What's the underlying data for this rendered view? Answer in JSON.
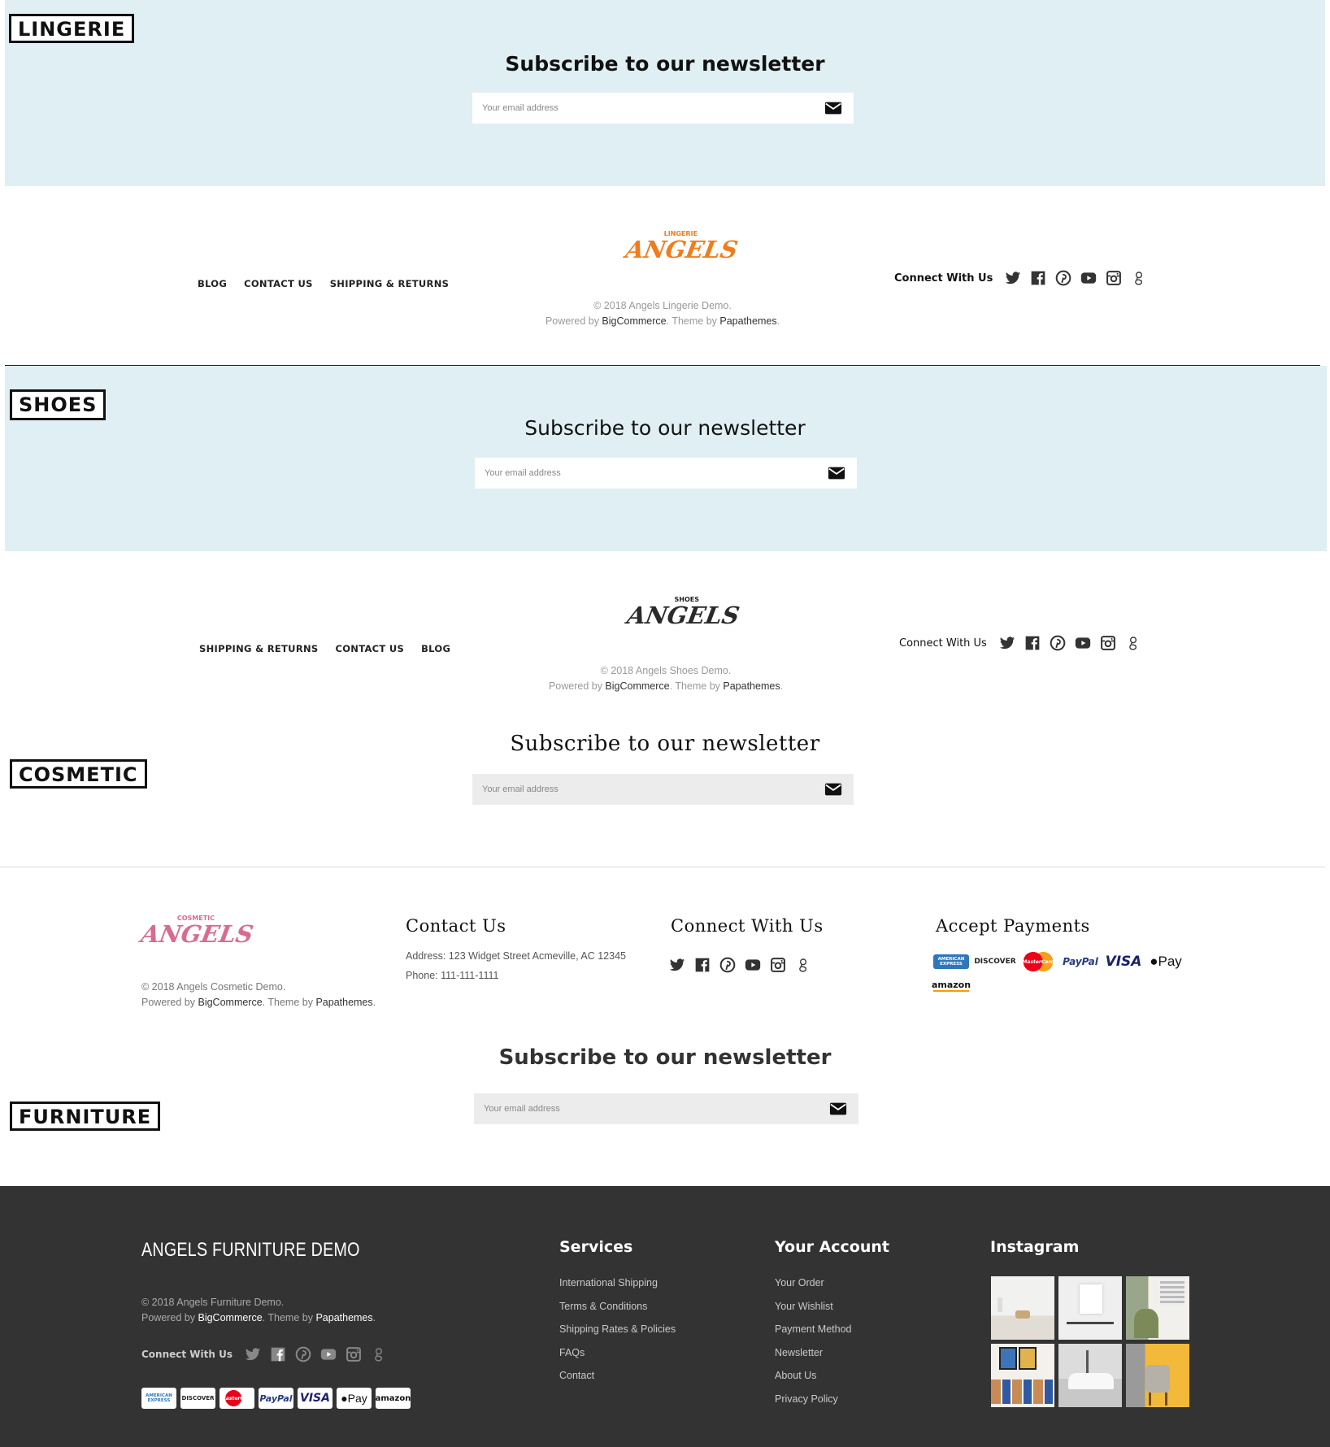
{
  "lingerie": {
    "tag": "LINGERIE",
    "newsletter_title": "Subscribe to our newsletter",
    "email_placeholder": "Your email address",
    "nav": [
      "BLOG",
      "CONTACT US",
      "SHIPPING & RETURNS"
    ],
    "logo_top": "LINGERIE",
    "logo_main": "ANGELS",
    "copyright": "© 2018 Angels Lingerie Demo.",
    "powered_prefix": "Powered by ",
    "bigcommerce": "BigCommerce",
    "theme_by": ". Theme by ",
    "papathemes": "Papathemes",
    "period": ".",
    "connect": "Connect With Us"
  },
  "shoes": {
    "tag": "SHOES",
    "newsletter_title": "Subscribe to our newsletter",
    "email_placeholder": "Your email address",
    "nav": [
      "SHIPPING & RETURNS",
      "CONTACT US",
      "BLOG"
    ],
    "logo_top": "SHOES",
    "logo_main": "ANGELS",
    "copyright": "© 2018 Angels Shoes Demo.",
    "powered_prefix": "Powered by ",
    "bigcommerce": "BigCommerce",
    "theme_by": ". Theme by ",
    "papathemes": "Papathemes",
    "period": ".",
    "connect": "Connect With Us"
  },
  "cosmetic": {
    "tag": "COSMETIC",
    "newsletter_title": "Subscribe to our newsletter",
    "email_placeholder": "Your email address",
    "logo_top": "COSMETIC",
    "logo_main": "ANGELS",
    "copyright": "© 2018 Angels Cosmetic Demo.",
    "powered_prefix": "Powered by ",
    "bigcommerce": "BigCommerce",
    "theme_by": ". Theme by ",
    "papathemes": "Papathemes",
    "period": ".",
    "contact_title": "Contact Us",
    "address": "Address: 123 Widget Street Acmeville, AC 12345",
    "phone": "Phone: 111-111-1111",
    "connect_title": "Connect With Us",
    "payments_title": "Accept Payments",
    "payments": [
      "AMERICAN EXPRESS",
      "DISCOVER",
      "MasterCard",
      "PayPal",
      "VISA",
      "Pay",
      "amazon"
    ]
  },
  "furniture": {
    "tag": "FURNITURE",
    "newsletter_title": "Subscribe to our newsletter",
    "email_placeholder": "Your email address",
    "brand": "ANGELS FURNITURE DEMO",
    "copyright": "© 2018 Angels Furniture Demo.",
    "powered_prefix": "Powered by ",
    "bigcommerce": "BigCommerce",
    "theme_by": ". Theme by ",
    "papathemes": "Papathemes",
    "period": ".",
    "connect": "Connect With Us",
    "payments": [
      "AMERICAN EXPRESS",
      "DISCOVER",
      "MasterCard",
      "PayPal",
      "VISA",
      "Pay",
      "amazon"
    ],
    "services_title": "Services",
    "services": [
      "International Shipping",
      "Terms & Conditions",
      "Shipping Rates & Policies",
      "FAQs",
      "Contact"
    ],
    "account_title": "Your Account",
    "account": [
      "Your Order",
      "Your Wishlist",
      "Payment Method",
      "Newsletter",
      "About Us",
      "Privacy Policy"
    ],
    "instagram_title": "Instagram"
  },
  "colors": {
    "band": "#dfeff4",
    "lingerie_logo": "#f07d1b",
    "cosmetic_logo": "#d96b8f",
    "dark_footer": "#333333"
  },
  "icons": [
    "envelope-icon",
    "twitter-icon",
    "facebook-icon",
    "pinterest-icon",
    "youtube-icon",
    "instagram-icon",
    "google-icon"
  ]
}
